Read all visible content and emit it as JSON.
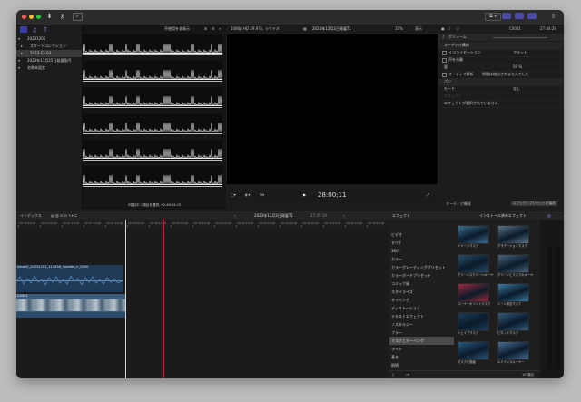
{
  "toolbar": {
    "icons": [
      "import-icon",
      "key-icon",
      "check-icon",
      "library-icon",
      "photos-icon",
      "titles-icon",
      "keyword-icon",
      "layout-icon",
      "browser-icon",
      "inspector-icon",
      "share-icon"
    ]
  },
  "library": {
    "items": [
      {
        "label": "20231202",
        "level": 0,
        "selected": false
      },
      {
        "label": "スマートコレクション",
        "level": 1,
        "selected": false
      },
      {
        "label": "2023-12-03",
        "level": 1,
        "selected": true
      },
      {
        "label": "2023年11月25日発展条円",
        "level": 0,
        "selected": false
      },
      {
        "label": "名称未設定",
        "level": 0,
        "selected": false
      }
    ]
  },
  "browser": {
    "filter": "不使用を非表示",
    "status": "3項目中 1項目を選択, 02:46:24:15",
    "clip_count": 6
  },
  "viewer": {
    "format": "1080p HD 29.97p, ラウドネ",
    "project": "2023年12月2日発展T1",
    "zoom": "35%",
    "view": "表示",
    "timecode": "28:00;11"
  },
  "inspector": {
    "title": "ボリューム",
    "clip_name": "C0001",
    "duration": "27:44:29",
    "rows": [
      {
        "label": "オーディオ構成",
        "value": "",
        "type": "header"
      },
      {
        "label": "イコライゼーション",
        "value": "フラット",
        "type": "check"
      },
      {
        "label": "声を分離",
        "value": "",
        "type": "check"
      },
      {
        "label": "量",
        "value": "50 %",
        "type": "value"
      },
      {
        "label": "オーディオ解析",
        "value": "問題は検出されませんでした",
        "type": "check"
      },
      {
        "label": "パン",
        "value": "",
        "type": "header"
      },
      {
        "label": "モード",
        "value": "なし",
        "type": "value"
      },
      {
        "label": "エフェクト",
        "value": "",
        "type": "dim"
      },
      {
        "label": "エフェクトが選択されていません",
        "value": "",
        "type": "note"
      }
    ],
    "footer_label": "オーディオ構成",
    "footer_button": "エフェクトプリセットを保存"
  },
  "timeline": {
    "index_label": "インデックス",
    "project": "2023年12月2日発展T1",
    "duration": "27:45:19",
    "ruler": [
      "00:26:45:00",
      "00:27:00:00",
      "00:27:15:00",
      "00:27:30:00",
      "00:27:45:00",
      "00:28:00:00",
      "00:28:15:00",
      "00:28:30:00",
      "00:28:45:00",
      "00:29:00:00",
      "00:29:15:00",
      "00:29:30:00",
      "00:29:45:00",
      "00:30:00:00",
      "00:30:15:00",
      "00:30:30:00",
      "00:30:45:00",
      "00:31:00:00",
      "00:31:15:00",
      "00:31:30:00",
      "00:31:45:00",
      "00:32:00:00",
      "00:32:15:00"
    ],
    "clip_audio_label": "ktaoh0_20231202_111458_Yoshida_h_0000",
    "clip_video_label": "C0001"
  },
  "effects": {
    "header": "エフェクト",
    "installed": "インストール済みエフェクト",
    "categories": [
      {
        "label": "ビデオ",
        "selected": false
      },
      {
        "label": "すべて",
        "selected": false
      },
      {
        "label": "360°",
        "selected": false
      },
      {
        "label": "カラー",
        "selected": false
      },
      {
        "label": "カラーグレーディングプリセット",
        "selected": false
      },
      {
        "label": "カラーボードプリセット",
        "selected": false
      },
      {
        "label": "コミック風",
        "selected": false
      },
      {
        "label": "スタイライズ",
        "selected": false
      },
      {
        "label": "タイリング",
        "selected": false
      },
      {
        "label": "ディストーション",
        "selected": false
      },
      {
        "label": "テキストエフェクト",
        "selected": false
      },
      {
        "label": "ノスタルジー",
        "selected": false
      },
      {
        "label": "ブラー",
        "selected": false
      },
      {
        "label": "マスクとキーイング",
        "selected": true
      },
      {
        "label": "ライト",
        "selected": false
      },
      {
        "label": "基本",
        "selected": false
      },
      {
        "label": "照明",
        "selected": false
      }
    ],
    "thumbs": [
      {
        "label": "イメージマスク",
        "color": "#3c6f8f"
      },
      {
        "label": "グラデーションマスク",
        "color": "#5a7288"
      },
      {
        "label": "グリーンスクリーンキーヤー",
        "color": "#2a4d6a"
      },
      {
        "label": "グリーンとマスクのキーヤー",
        "color": "#4a6580"
      },
      {
        "label": "コーナーポイントマスク",
        "color": "#a02a3e"
      },
      {
        "label": "シーン除去マスク",
        "color": "#3a7aa0"
      },
      {
        "label": "シェイプマスク",
        "color": "#1c3c5a"
      },
      {
        "label": "ビネットマスク",
        "color": "#355a7c"
      },
      {
        "label": "マスクを描画",
        "color": "#2a5a80"
      },
      {
        "label": "ルミナンスキーヤー",
        "color": "#4a6f9a"
      }
    ],
    "search_placeholder": "",
    "count": "10 項目"
  }
}
